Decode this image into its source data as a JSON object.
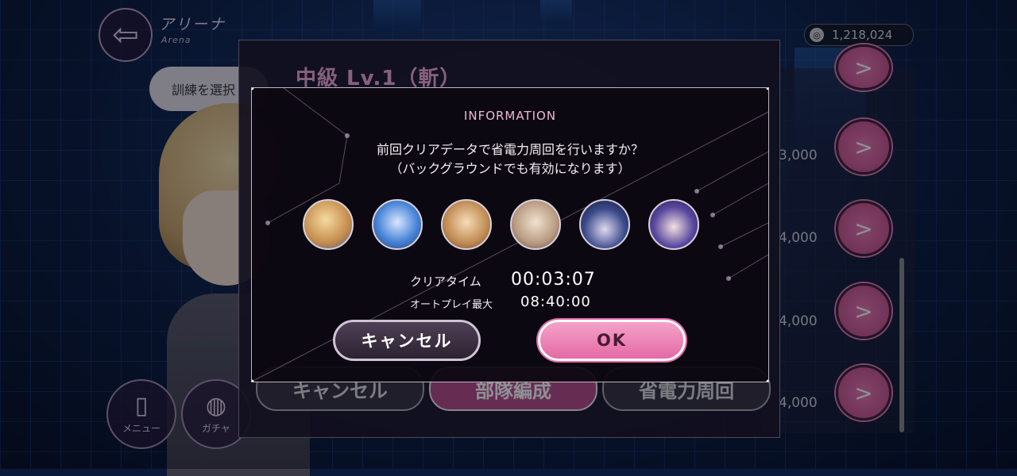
{
  "header": {
    "back_icon": "back-arrow-icon",
    "title": "アリーナ",
    "subtitle": "Arena",
    "currency_value": "1,218,024",
    "currency_icon": "coin-icon"
  },
  "side": {
    "select_chip_label": "訓練を選択",
    "menu_label": "メニュー",
    "gacha_label": "ガチャ"
  },
  "stage": {
    "title": "中級 Lv.1（斬）",
    "buttons": [
      "キャンセル",
      "部隊編成",
      "省電力周回"
    ]
  },
  "right_list": {
    "costs": [
      "3,000",
      "4,000",
      "4,000",
      "4,000"
    ]
  },
  "modal": {
    "title": "INFORMATION",
    "message_line1": "前回クリアデータで省電力周回を行いますか？",
    "message_line2": "（バックグラウンドでも有効になります）",
    "party_count": 6,
    "clear_time_label": "クリアタイム",
    "clear_time_value": "00:03:07",
    "auto_play_label": "オートプレイ最大",
    "auto_play_value": "08:40:00",
    "cancel_label": "キャンセル",
    "ok_label": "OK"
  },
  "colors": {
    "accent_pink": "#e46aa6",
    "title_pink": "#f0b8d8",
    "panel_dark": "#0c0810"
  }
}
